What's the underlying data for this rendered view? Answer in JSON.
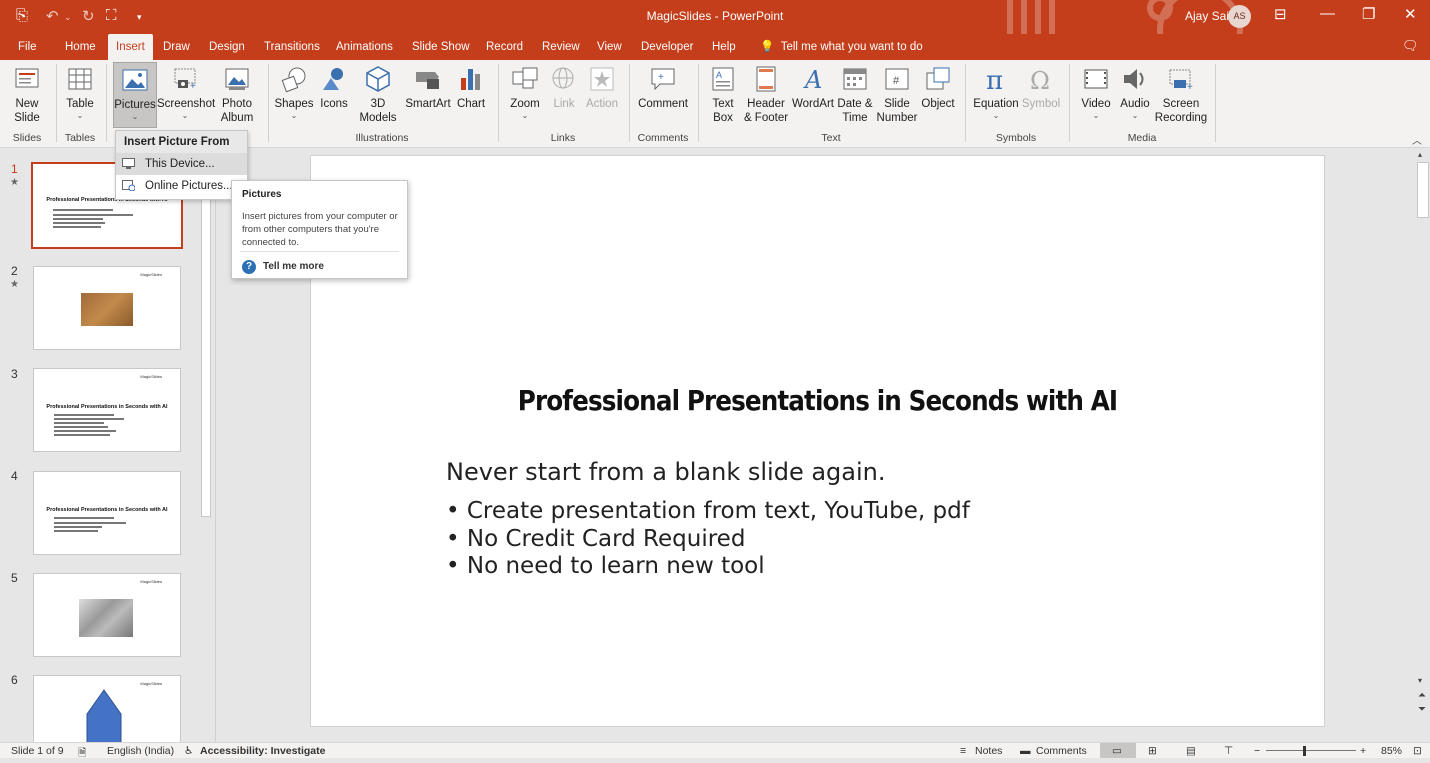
{
  "window": {
    "title": "MagicSlides  -  PowerPoint",
    "user_name": "Ajay Sai",
    "user_initials": "AS"
  },
  "tabs": [
    "File",
    "Home",
    "Insert",
    "Draw",
    "Design",
    "Transitions",
    "Animations",
    "Slide Show",
    "Record",
    "Review",
    "View",
    "Developer",
    "Help"
  ],
  "active_tab": "Insert",
  "tell_me": "Tell me what you want to do",
  "ribbon": {
    "new_slide": "New\nSlide",
    "table": "Table",
    "pictures": "Pictures",
    "screenshot": "Screenshot",
    "photo_album": "Photo\nAlbum",
    "shapes": "Shapes",
    "icons": "Icons",
    "models3d": "3D\nModels",
    "smartart": "SmartArt",
    "chart": "Chart",
    "zoom": "Zoom",
    "link": "Link",
    "action": "Action",
    "comment": "Comment",
    "textbox": "Text\nBox",
    "header_footer": "Header\n& Footer",
    "wordart": "WordArt",
    "datetime": "Date &\nTime",
    "slide_number": "Slide\nNumber",
    "object": "Object",
    "equation": "Equation",
    "symbol": "Symbol",
    "video": "Video",
    "audio": "Audio",
    "screen_recording": "Screen\nRecording",
    "groups": {
      "slides": "Slides",
      "tables": "Tables",
      "illustrations": "Illustrations",
      "links": "Links",
      "comments": "Comments",
      "text": "Text",
      "symbols": "Symbols",
      "media": "Media"
    }
  },
  "dropdown": {
    "header": "Insert Picture From",
    "items": [
      "This Device...",
      "Online Pictures..."
    ]
  },
  "tooltip": {
    "title": "Pictures",
    "body": "Insert pictures from your computer or from other computers that you're connected to.",
    "more": "Tell me more"
  },
  "slides_panel": {
    "numbers": [
      "1",
      "2",
      "3",
      "4",
      "5",
      "6"
    ],
    "thumb_logo": "MagicSlides",
    "thumb_title": "Professional Presentations in Seconds with AI"
  },
  "slide": {
    "title": "Professional Presentations in Seconds with AI",
    "subtitle": "Never start from a blank slide again.",
    "bullets": [
      "• Create presentation from text, YouTube, pdf",
      "• No Credit Card Required",
      "• No need to learn new tool"
    ]
  },
  "status": {
    "slide_info": "Slide 1 of 9",
    "language": "English (India)",
    "accessibility": "Accessibility: Investigate",
    "notes": "Notes",
    "comments": "Comments",
    "zoom": "85%"
  },
  "colors": {
    "accent": "#c43e1c",
    "ribbon_bg": "#f3f2f1",
    "icon_blue": "#3a6fb0"
  }
}
